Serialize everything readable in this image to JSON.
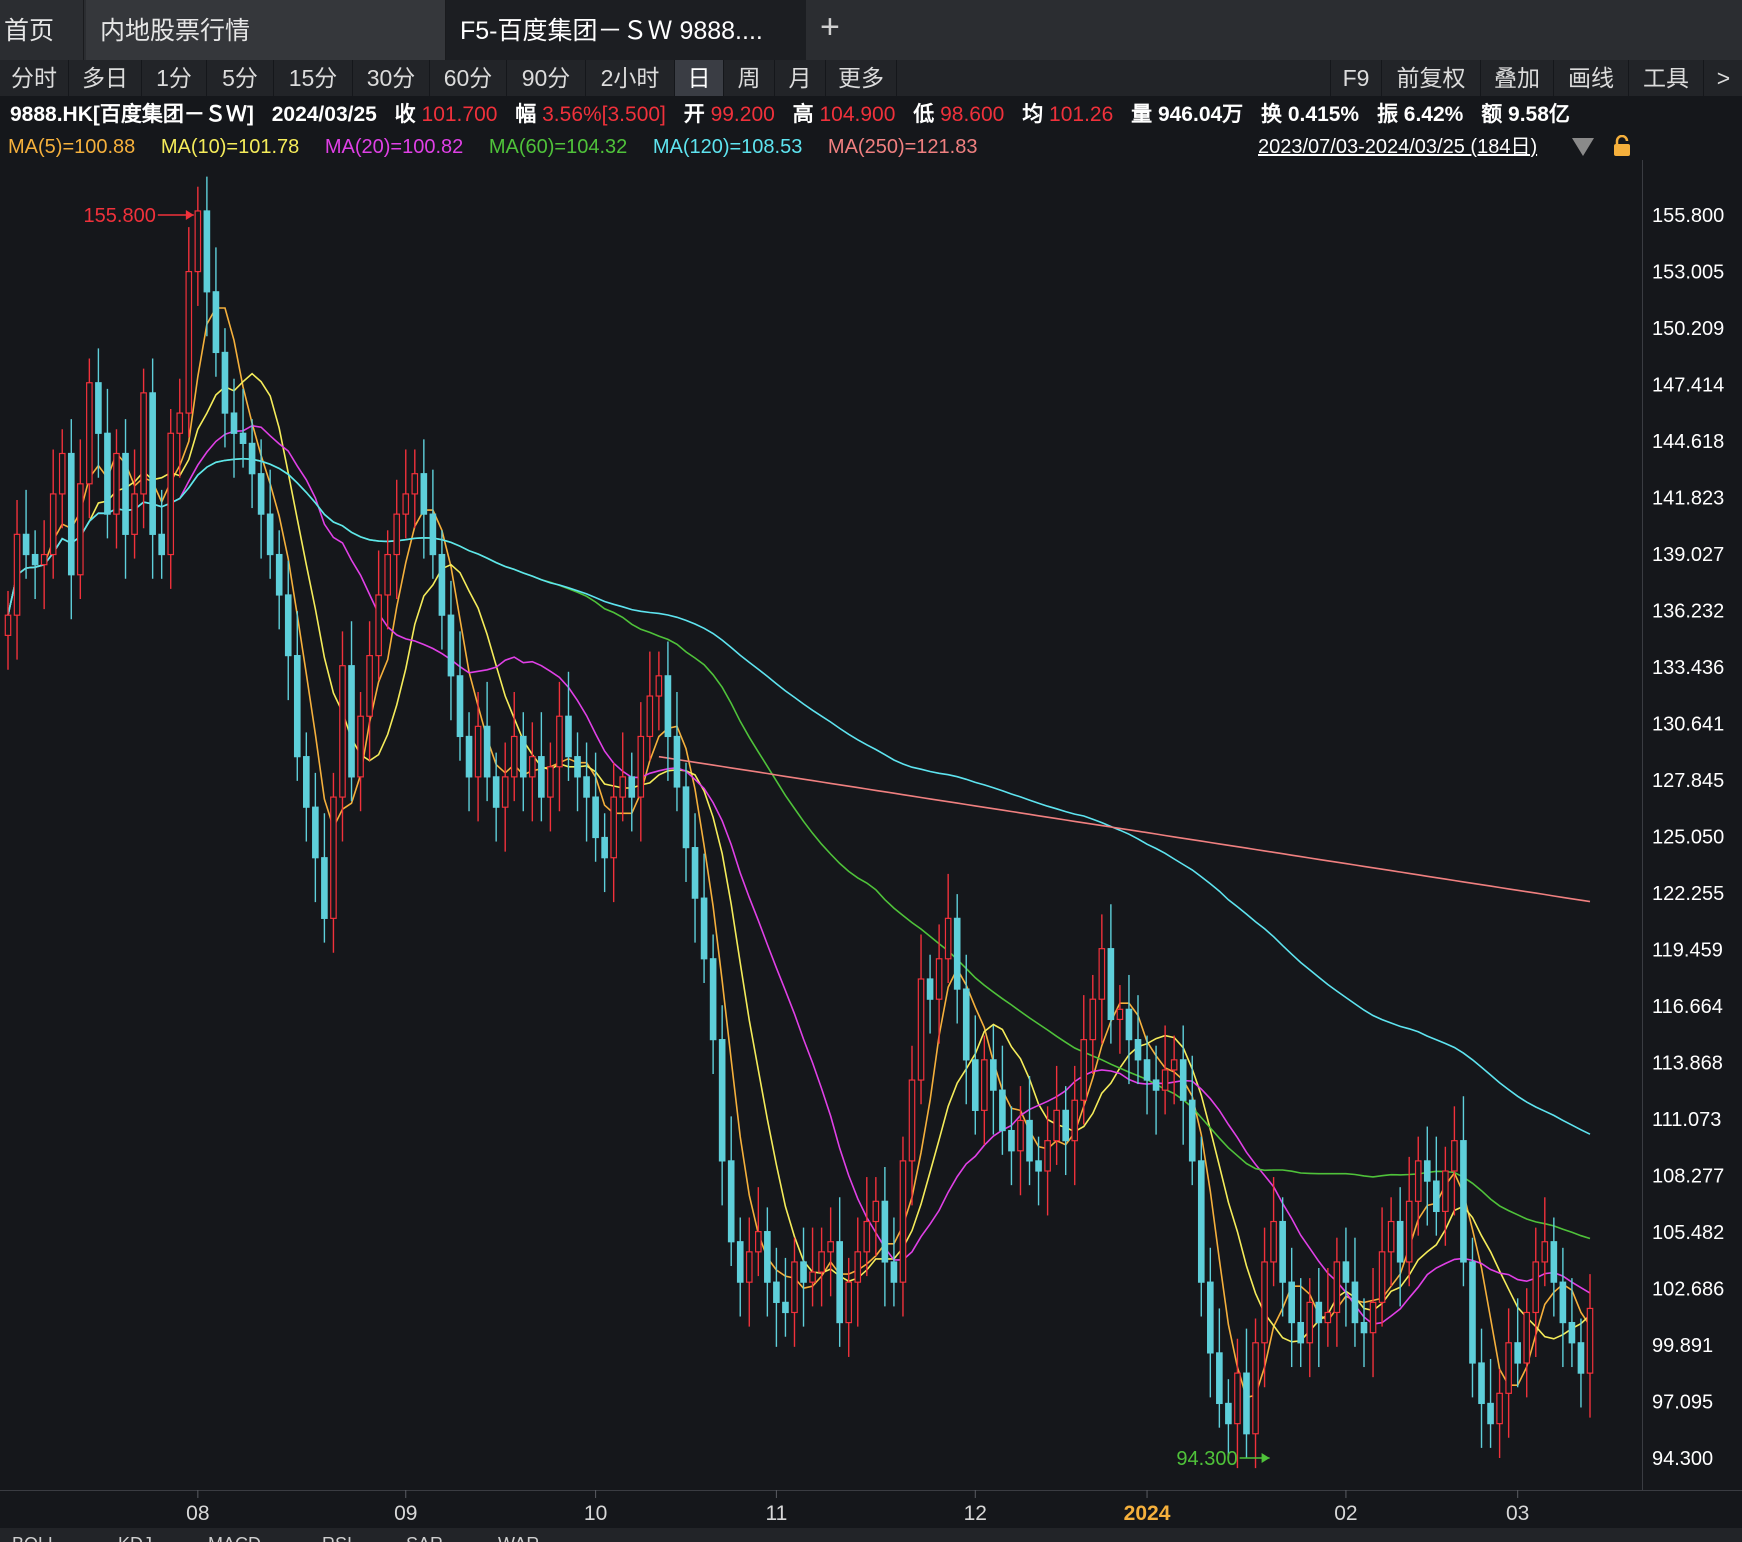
{
  "tabs": [
    {
      "label": "首页"
    },
    {
      "label": "内地股票行情"
    },
    {
      "label": "F5-百度集团－ＳＷ 9888...."
    }
  ],
  "tab_add": "+",
  "periods": [
    "分时",
    "多日",
    "1分",
    "5分",
    "15分",
    "30分",
    "60分",
    "90分",
    "2小时",
    "日",
    "周",
    "月",
    "更多"
  ],
  "active_period": "日",
  "tools": [
    "F9",
    "前复权",
    "叠加",
    "画线",
    "工具",
    ">"
  ],
  "info": {
    "code": "9888.HK[百度集团－ＳＷ]",
    "date": "2024/03/25",
    "close_label": "收",
    "close": "101.700",
    "change_label": "幅",
    "change": "3.56%[3.500]",
    "open_label": "开",
    "open": "99.200",
    "high_label": "高",
    "high": "104.900",
    "low_label": "低",
    "low": "98.600",
    "avg_label": "均",
    "avg": "101.26",
    "volume_label": "量",
    "volume": "946.04万",
    "turnover_label": "换",
    "turnover": "0.415%",
    "amplitude_label": "振",
    "amplitude": "6.42%",
    "amount_label": "额",
    "amount": "9.58亿"
  },
  "ma_legend": [
    {
      "text": "MA(5)=100.88",
      "color": "#f5b03c"
    },
    {
      "text": "MA(10)=101.78",
      "color": "#f5ec5a"
    },
    {
      "text": "MA(20)=100.82",
      "color": "#e040e6"
    },
    {
      "text": "MA(60)=104.32",
      "color": "#4fc23a"
    },
    {
      "text": "MA(120)=108.53",
      "color": "#5ee4f0"
    },
    {
      "text": "MA(250)=121.83",
      "color": "#f08080"
    }
  ],
  "date_range": "2023/07/03-2024/03/25 (184日)",
  "indicator_tabs": [
    "BOLL",
    "KDJ",
    "MACD",
    "RSI",
    "SAR",
    "WAR"
  ],
  "colors": {
    "up": "#f0313b",
    "down": "#5ecfda",
    "background": "#15171b",
    "axis_text": "#ffffff"
  },
  "chart_data": {
    "type": "candlestick",
    "title": "",
    "x_labels": [
      "08",
      "09",
      "10",
      "11",
      "12",
      "2024",
      "02",
      "03"
    ],
    "x_label_index": [
      21,
      44,
      65,
      85,
      107,
      126,
      148,
      167
    ],
    "y_ticks": [
      "155.800",
      "153.005",
      "150.209",
      "147.414",
      "144.618",
      "141.823",
      "139.027",
      "136.232",
      "133.436",
      "130.641",
      "127.845",
      "125.050",
      "122.255",
      "119.459",
      "116.664",
      "113.868",
      "111.073",
      "108.277",
      "105.482",
      "102.686",
      "99.891",
      "97.095",
      "94.300"
    ],
    "ylim": [
      94.3,
      155.8
    ],
    "max_label": "155.800",
    "max_index": 21,
    "min_label": "94.300",
    "min_index": 140,
    "close": [
      136,
      140,
      139,
      138.5,
      139,
      142,
      144,
      138,
      142.5,
      147.5,
      145,
      141,
      144,
      140,
      142,
      147,
      140,
      139,
      145,
      146,
      153,
      156,
      152,
      149,
      146,
      145,
      144.5,
      143,
      141,
      139,
      137,
      134,
      129,
      126.5,
      124,
      121,
      127,
      133.5,
      128,
      131,
      134,
      137,
      139,
      141,
      142,
      143,
      141,
      139,
      136,
      133,
      130,
      128,
      130.5,
      128,
      126.5,
      128,
      130,
      128,
      129,
      127,
      128.5,
      131,
      129,
      128,
      127,
      125,
      124,
      127,
      128,
      127,
      130,
      132,
      133,
      130,
      127.5,
      124.5,
      122,
      119,
      115,
      109,
      105,
      103,
      104.5,
      105.5,
      103,
      102,
      101.5,
      104,
      103,
      103.5,
      104.5,
      105,
      101,
      103,
      104.5,
      106,
      107,
      104,
      103,
      109,
      113,
      118,
      117,
      119,
      121,
      117.5,
      114,
      111.5,
      114,
      112.5,
      110.5,
      109.5,
      111,
      109,
      108.5,
      110,
      111.5,
      110,
      112,
      115,
      117,
      119.5,
      116,
      116.5,
      115,
      114,
      113,
      112.5,
      113.5,
      114,
      112,
      109,
      103,
      99.5,
      97,
      96,
      98.5,
      95.5,
      100,
      104,
      106,
      103,
      101,
      100,
      102,
      101,
      101.5,
      104,
      103,
      101,
      100.5,
      102,
      104.5,
      106,
      104,
      107,
      109,
      108,
      106.5,
      108.5,
      110,
      104,
      99,
      97,
      96,
      97.5,
      100,
      99,
      101.5,
      104,
      105,
      103,
      101,
      100,
      98.5,
      101.7
    ]
  }
}
